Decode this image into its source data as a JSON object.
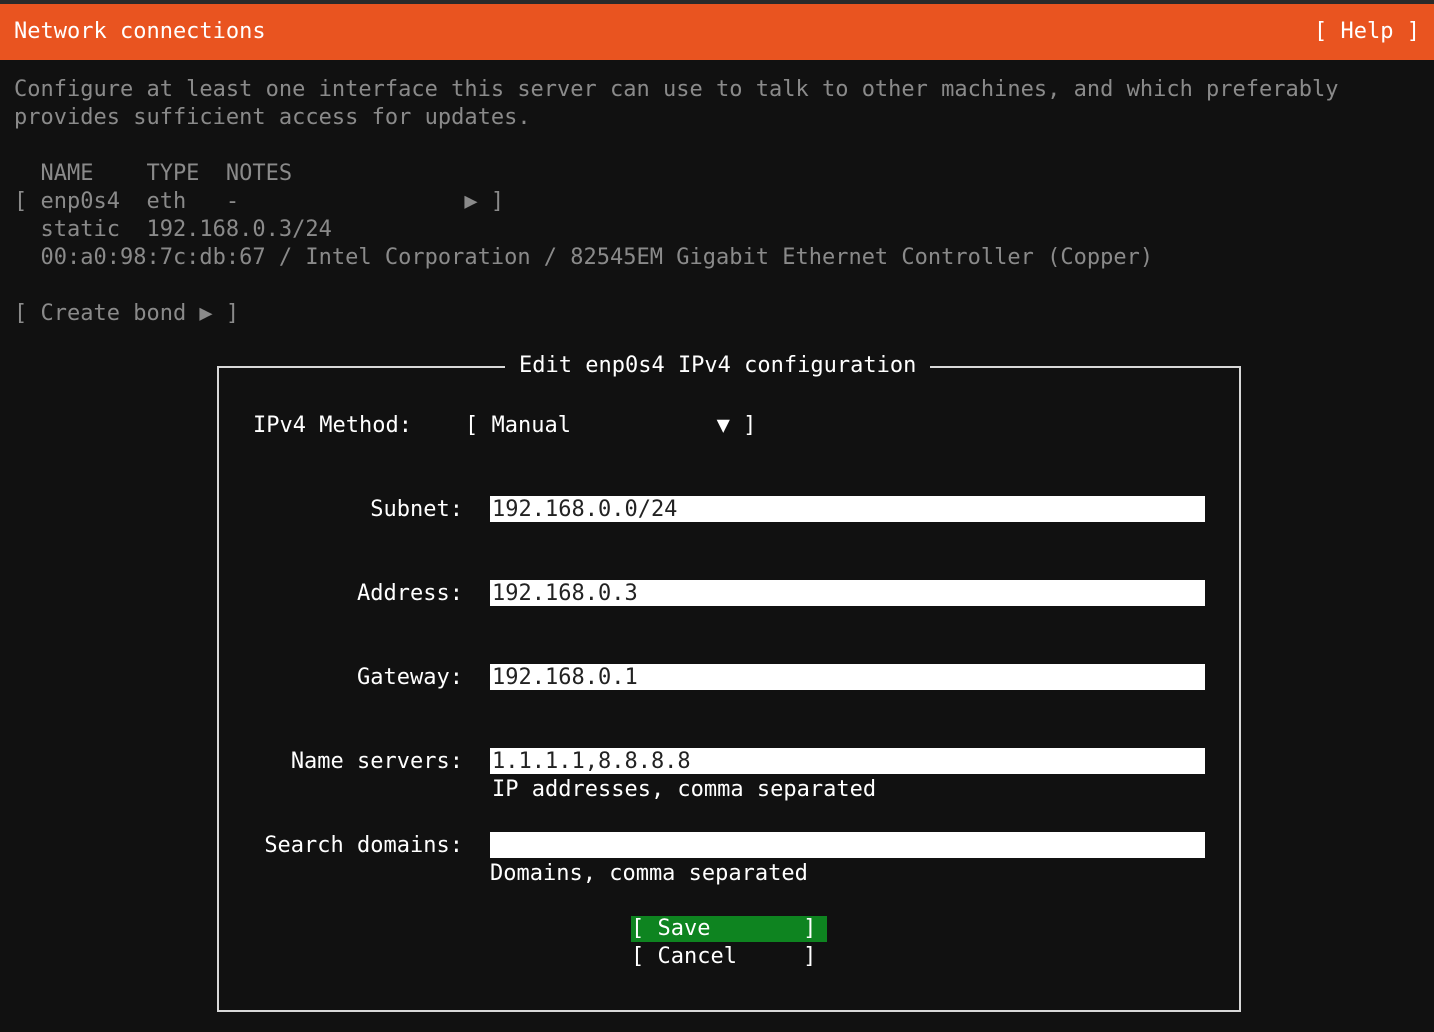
{
  "header": {
    "title": "Network connections",
    "help": "[ Help ]"
  },
  "description": "Configure at least one interface this server can use to talk to other machines, and which preferably\nprovides sufficient access for updates.",
  "interfaces_table": {
    "headers": [
      "NAME",
      "TYPE",
      "NOTES"
    ],
    "header_line": "  NAME    TYPE  NOTES",
    "rows": [
      {
        "line": "[ enp0s4  eth   -                 ▶ ]",
        "name": "enp0s4",
        "type": "eth",
        "notes": "-"
      }
    ],
    "detail_static": "  static  192.168.0.3/24",
    "detail_hw": "  00:a0:98:7c:db:67 / Intel Corporation / 82545EM Gigabit Ethernet Controller (Copper)"
  },
  "create_bond": "[ Create bond ▶ ]",
  "dialog": {
    "title": "Edit enp0s4 IPv4 configuration",
    "method_label": "IPv4 Method:",
    "method_value": "[ Manual           ▼ ]",
    "fields": {
      "subnet": {
        "label": "Subnet:",
        "value": "192.168.0.0/24"
      },
      "address": {
        "label": "Address:",
        "value": "192.168.0.3"
      },
      "gateway": {
        "label": "Gateway:",
        "value": "192.168.0.1"
      },
      "name_servers": {
        "label": "Name servers:",
        "value": "1.1.1.1,8.8.8.8",
        "hint": "IP addresses, comma separated"
      },
      "search_domains": {
        "label": "Search domains:",
        "value": "",
        "hint": "Domains, comma separated"
      }
    },
    "save": "[ Save       ]",
    "cancel": "[ Cancel     ]"
  },
  "colors": {
    "accent": "#e95420",
    "background": "#111111",
    "save_button": "#0e8420"
  },
  "icons": [
    "right-arrow-icon",
    "dropdown-arrow-icon"
  ]
}
